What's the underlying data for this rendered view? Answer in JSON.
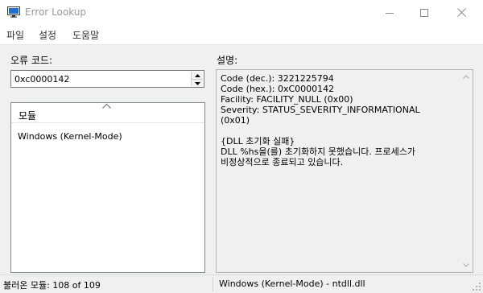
{
  "window": {
    "title": "Error Lookup",
    "icon": "monitor-icon",
    "controls": [
      "minimize-icon",
      "maximize-icon",
      "close-icon"
    ]
  },
  "menu": {
    "items": [
      "파일",
      "설정",
      "도움말"
    ]
  },
  "error_code": {
    "label": "오류 코드:",
    "value": "0xc0000142"
  },
  "modules": {
    "column_header": "모듈",
    "items": [
      "Windows (Kernel-Mode)"
    ]
  },
  "description": {
    "label": "설명:",
    "text": "Code (dec.): 3221225794\nCode (hex.): 0xC0000142\nFacility: FACILITY_NULL (0x00)\nSeverity: STATUS_SEVERITY_INFORMATIONAL\n(0x01)\n\n{DLL 초기화 실패}\nDLL %hs을(를) 초기화하지 못했습니다. 프로세스가\n비정상적으로 종료되고 있습니다."
  },
  "status": {
    "loaded_modules": "불러온 모듈: 108 of 109",
    "current_module": "Windows (Kernel-Mode) - ntdll.dll"
  },
  "colors": {
    "background": "#f0f0f0",
    "titlebar": "#ffffff",
    "title_text": "#999999",
    "icon_accent": "#1e6fd0"
  }
}
